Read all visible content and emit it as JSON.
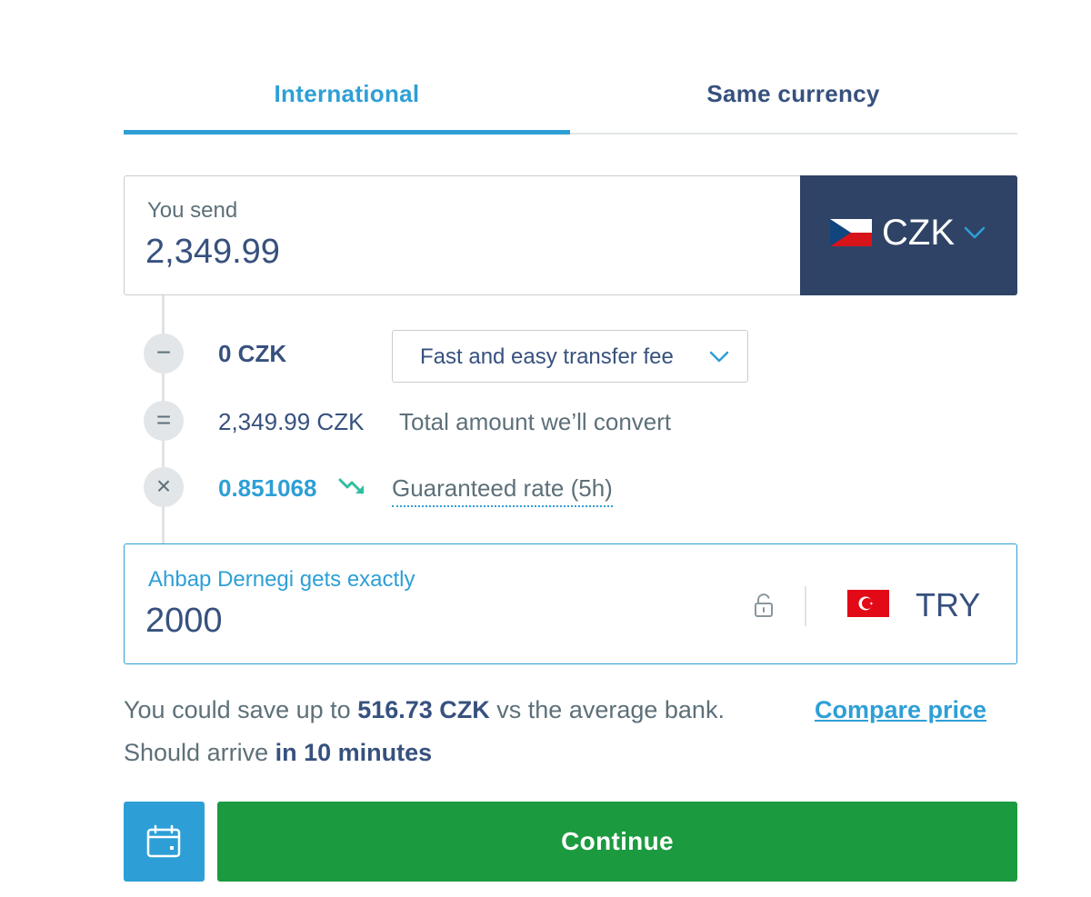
{
  "tabs": [
    {
      "label": "International",
      "active": true
    },
    {
      "label": "Same currency",
      "active": false
    }
  ],
  "send": {
    "label": "You send",
    "amount": "2,349.99",
    "currency": "CZK",
    "flag_icon": "flag-czech-icon"
  },
  "breakdown": {
    "fee_amount": "0 CZK",
    "fee_type": "Fast and easy transfer fee",
    "convert_amount": "2,349.99 CZK",
    "convert_label": "Total amount we’ll convert",
    "rate": "0.851068",
    "rate_trend_icon": "trend-down-icon",
    "rate_label": "Guaranteed rate (5h)",
    "symbols": {
      "minus": "−",
      "equals": "=",
      "times": "×"
    }
  },
  "receive": {
    "label": "Ahbap Dernegi gets exactly",
    "amount": "2000",
    "currency": "TRY",
    "flag_icon": "flag-turkey-icon",
    "lock_icon": "unlock-icon"
  },
  "info": {
    "save_prefix": "You could save up to ",
    "save_amount": "516.73 CZK",
    "save_suffix": " vs the average bank.",
    "compare_link": "Compare price",
    "arrive_prefix": "Should arrive ",
    "arrive_time": "in 10 minutes"
  },
  "actions": {
    "continue_label": "Continue",
    "schedule_icon": "calendar-icon"
  },
  "colors": {
    "accent": "#2e9fd6",
    "navy": "#2f4366",
    "text": "#37517e",
    "muted": "#5d7079",
    "success": "#1b9a3f"
  }
}
